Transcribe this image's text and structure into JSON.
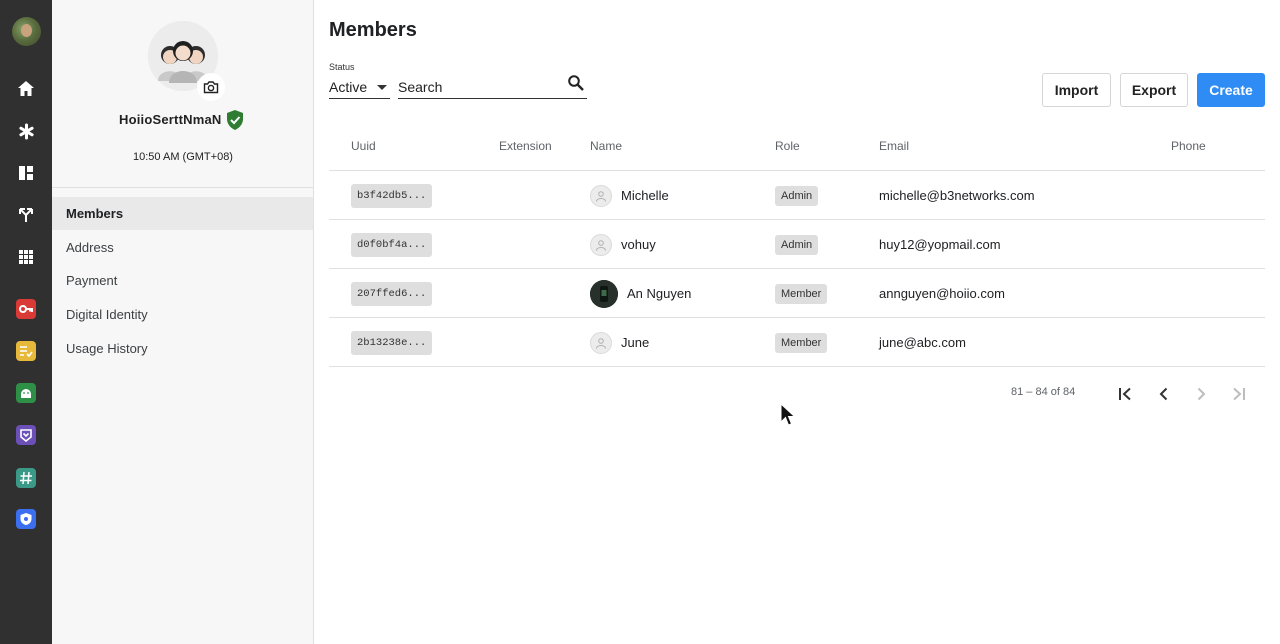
{
  "rail": {
    "icons": [
      "user-avatar",
      "home-icon",
      "asterisk-icon",
      "dashboard-icon",
      "routing-icon",
      "apps-grid-icon",
      "key-app-icon",
      "tasks-app-icon",
      "android-app-icon",
      "pilot-app-icon",
      "hashtag-app-icon",
      "shield-app-icon"
    ],
    "app_colors": {
      "key": "#d93a36",
      "tasks": "#e7b93b",
      "android": "#2e8f47",
      "pilot": "#6d4fb8",
      "hashtag": "#3a9a87",
      "shield": "#3b6ff0"
    }
  },
  "profile": {
    "name": "HoiioSerttNmaN",
    "time": "10:50 AM (GMT+08)"
  },
  "nav": [
    {
      "label": "Members",
      "active": true
    },
    {
      "label": "Address"
    },
    {
      "label": "Payment"
    },
    {
      "label": "Digital Identity"
    },
    {
      "label": "Usage History"
    }
  ],
  "page": {
    "title": "Members"
  },
  "filter": {
    "status_label": "Status",
    "status_value": "Active",
    "search_placeholder": "Search"
  },
  "actions": {
    "import": "Import",
    "export": "Export",
    "create": "Create"
  },
  "table": {
    "headers": {
      "uuid": "Uuid",
      "extension": "Extension",
      "name": "Name",
      "role": "Role",
      "email": "Email",
      "phone": "Phone"
    },
    "rows": [
      {
        "uuid": "b3f42db5...",
        "extension": "",
        "name": "Michelle",
        "role": "Admin",
        "email": "michelle@b3networks.com",
        "phone": "",
        "avatar": "default"
      },
      {
        "uuid": "d0f0bf4a...",
        "extension": "",
        "name": "vohuy",
        "role": "Admin",
        "email": "huy12@yopmail.com",
        "phone": "",
        "avatar": "default"
      },
      {
        "uuid": "207ffed6...",
        "extension": "",
        "name": "An Nguyen",
        "role": "Member",
        "email": "annguyen@hoiio.com",
        "phone": "",
        "avatar": "photo"
      },
      {
        "uuid": "2b13238e...",
        "extension": "",
        "name": "June",
        "role": "Member",
        "email": "june@abc.com",
        "phone": "",
        "avatar": "default"
      }
    ]
  },
  "pagination": {
    "range_text": "81 – 84 of 84"
  },
  "colors": {
    "primary": "#2f8cf5",
    "verified": "#2e7d32",
    "rail_bg": "#303030"
  }
}
